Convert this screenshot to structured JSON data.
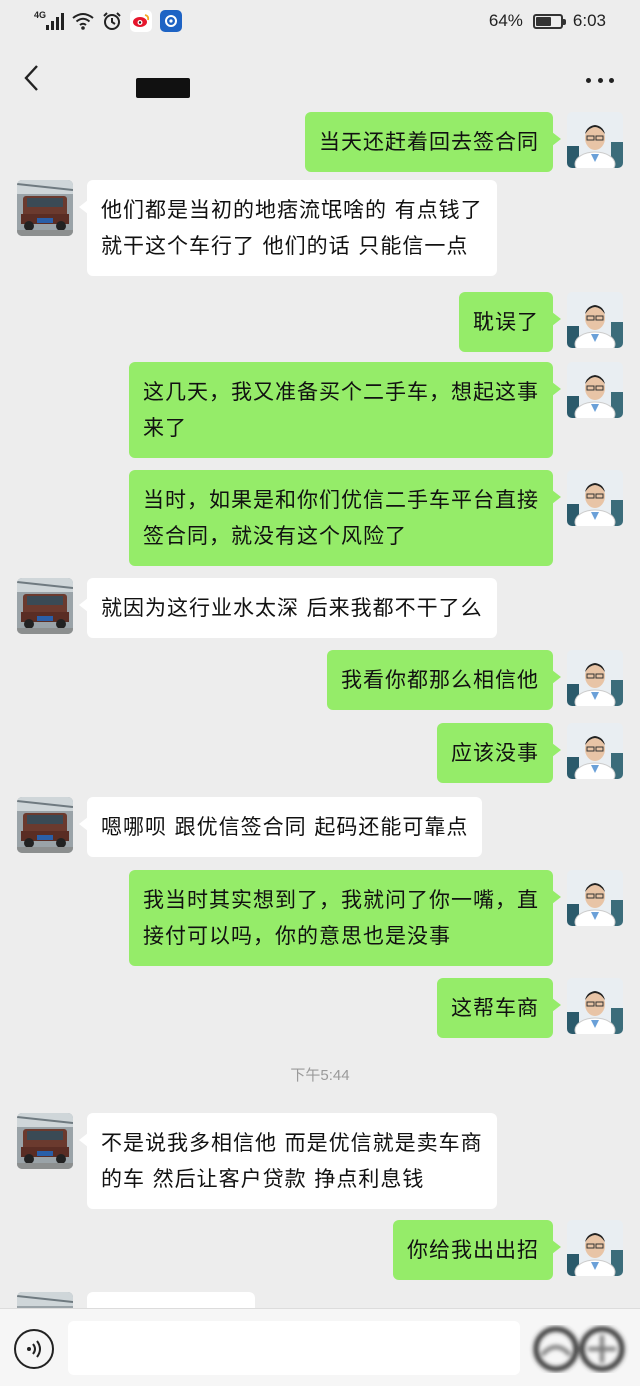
{
  "status_bar": {
    "network": "4G",
    "battery": "64%",
    "battery_level": 0.64,
    "time": "6:03"
  },
  "header": {
    "back_icon": "chevron-left-icon",
    "more_icon": "more-dots-icon"
  },
  "messages": [
    {
      "side": "me",
      "text": "当天还赶着回去签合同"
    },
    {
      "side": "them",
      "text": "他们都是当初的地痞流氓啥的 有点钱了\n就干这个车行了  他们的话 只能信一点"
    },
    {
      "side": "me",
      "text": "耽误了"
    },
    {
      "side": "me",
      "text": "这几天，我又准备买个二手车，想起这事\n来了"
    },
    {
      "side": "me",
      "text": "当时，如果是和你们优信二手车平台直接\n签合同，就没有这个风险了"
    },
    {
      "side": "them",
      "text": "就因为这行业水太深 后来我都不干了么"
    },
    {
      "side": "me",
      "text": "我看你都那么相信他"
    },
    {
      "side": "me",
      "text": "应该没事"
    },
    {
      "side": "them",
      "text": "嗯哪呗  跟优信签合同 起码还能可靠点"
    },
    {
      "side": "me",
      "text": "我当时其实想到了，我就问了你一嘴，直\n接付可以吗，你的意思也是没事"
    },
    {
      "side": "me",
      "text": "这帮车商"
    },
    {
      "timestamp": "下午5:44"
    },
    {
      "side": "them",
      "text": "不是说我多相信他  而是优信就是卖车商\n的车 然后让客户贷款  挣点利息钱"
    },
    {
      "side": "me",
      "text": "你给我出出招"
    }
  ],
  "input": {
    "placeholder": "",
    "voice_icon": "voice-icon"
  },
  "colors": {
    "background": "#ededed",
    "my_bubble": "#95ec69",
    "their_bubble": "#ffffff"
  }
}
